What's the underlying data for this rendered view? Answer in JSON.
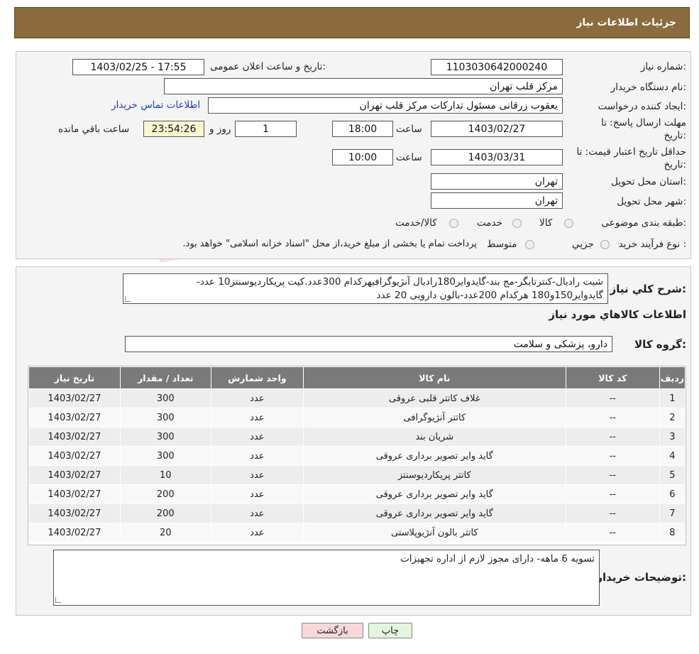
{
  "header": {
    "title": "جزئیات اطلاعات نیاز"
  },
  "form": {
    "need_number_label": "شماره نیاز:",
    "need_number": "1103030642000240",
    "announce_label": "تاریخ و ساعت اعلان عمومی:",
    "announce_value": "1403/02/25 - 17:55",
    "buyer_org_label": "نام دستگاه خریدار:",
    "buyer_org": "مرکز قلب تهران",
    "creator_label": "ایجاد کننده درخواست:",
    "creator": "یعقوب زرقانی مسئول تدارکات مرکز قلب تهران",
    "contact_link": "اطلاعات تماس خریدار",
    "deadline_label_1": "مهلت ارسال پاسخ: تا",
    "deadline_label_2": "تاریخ:",
    "deadline_date": "1403/02/27",
    "time_label": "ساعت",
    "deadline_time": "18:00",
    "days_value": "1",
    "days_label": "روز و",
    "remaining_time": "23:54:26",
    "remaining_label": "ساعت باقي مانده",
    "validity_label_1": "حداقل تاریخ اعتبار قیمت: تا",
    "validity_label_2": "تاریخ:",
    "validity_date": "1403/03/31",
    "validity_time": "10:00",
    "province_label": "استان محل تحویل:",
    "province": "تهران",
    "city_label": "شهر محل تحویل:",
    "city": "تهران",
    "category_label": "طبقه بندی موضوعی:",
    "category_options": [
      "کالا",
      "خدمت",
      "کالا/خدمت"
    ],
    "purchase_type_label": "نوع فرآیند خرید :",
    "purchase_options": [
      "جزیي",
      "متوسط"
    ],
    "purchase_note": "پرداخت تمام یا بخشی از مبلغ خرید،از محل \"اسناد خزانه اسلامی\" خواهد بود."
  },
  "description": {
    "label": "شرح کلي نياز:",
    "text": "شیت رادیال-کنترتایگر-مج بند-گایدوایر180رادیال آنژیوگرافیهرکدام 300عدد.کیت پریکاردیوسنتز10 عدد-گایدوایر150و180 هرکدام 200عدد-بالون دارویی 20 عدد"
  },
  "goods": {
    "section_title": "اطلاعات کالاهاي مورد نياز",
    "group_label": "گروه کالا:",
    "group_value": "دارو، پزشکی و سلامت",
    "columns": [
      "ردیف",
      "کد کالا",
      "نام کالا",
      "واحد شمارش",
      "تعداد / مقدار",
      "تاریخ نیاز"
    ],
    "rows": [
      [
        "1",
        "--",
        "غلاف کاتتر قلبی عروقی",
        "عدد",
        "300",
        "1403/02/27"
      ],
      [
        "2",
        "--",
        "کاتتر آنژیوگرافی",
        "عدد",
        "300",
        "1403/02/27"
      ],
      [
        "3",
        "--",
        "شریان بند",
        "عدد",
        "300",
        "1403/02/27"
      ],
      [
        "4",
        "--",
        "گاید وایر تصویر برداری عروقی",
        "عدد",
        "300",
        "1403/02/27"
      ],
      [
        "5",
        "--",
        "کاتتر پریکاردیوسنتز",
        "عدد",
        "10",
        "1403/02/27"
      ],
      [
        "6",
        "--",
        "گاید وایر تصویر برداری عروقی",
        "عدد",
        "200",
        "1403/02/27"
      ],
      [
        "7",
        "--",
        "گاید وایر تصویر برداری عروقی",
        "عدد",
        "200",
        "1403/02/27"
      ],
      [
        "8",
        "--",
        "کاتتر بالون آنژیوپلاستی",
        "عدد",
        "20",
        "1403/02/27"
      ]
    ]
  },
  "buyer_notes": {
    "label": "توضیحات خریدار:",
    "text": "تسویه 6 ماهه- دارای مجوز لازم از اداره تجهیزات"
  },
  "buttons": {
    "print": "چاپ",
    "back": "بازگشت"
  },
  "colors": {
    "header_bg": "#8b6b3d",
    "link": "#1f3fbf",
    "table_header": "#7a7a7a",
    "back_button": "#f6d8d8",
    "print_button": "#e4f4dd"
  }
}
